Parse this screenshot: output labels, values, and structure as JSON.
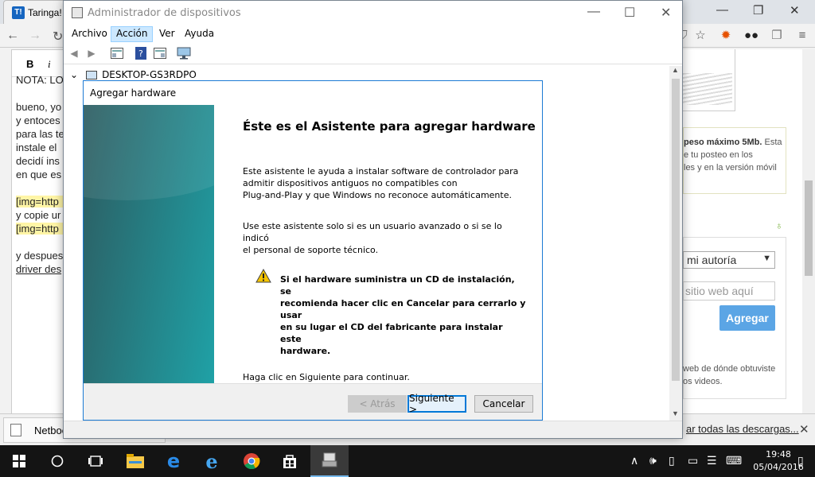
{
  "browser": {
    "tab_title": "Taringa!",
    "tab_logo": "T!",
    "window_controls": {
      "minimize": "—",
      "maximize": "❐",
      "close": "✕"
    },
    "editor": {
      "toolbar": {
        "bold": "B",
        "italic": "i"
      },
      "lines": [
        "NOTA: LO",
        "bueno, yo",
        "y entoces",
        "para las te",
        "instale el",
        "decidí ins",
        "en que es",
        "[img=http",
        "y copie ur",
        "[img=http",
        "y despues",
        "driver des"
      ]
    },
    "right_panel": {
      "upload_note_bold": "peso máximo 5Mb.",
      "upload_note_1": " Esta",
      "upload_note_2": "e tu posteo en los",
      "upload_note_3": "les y en la versión móvil",
      "source_select": "mi autoría",
      "site_placeholder": "sitio web aquí",
      "add_button": "Agregar",
      "source_note_1": "web de dónde obtuviste",
      "source_note_2": "os videos."
    },
    "downloads": {
      "item_name": "Netboo",
      "show_all": "ar todas las descargas..."
    }
  },
  "device_manager": {
    "title": "Administrador de dispositivos",
    "menu": [
      "Archivo",
      "Acción",
      "Ver",
      "Ayuda"
    ],
    "tree_root": "DESKTOP-GS3RDPO"
  },
  "wizard": {
    "title": "Agregar hardware",
    "heading": "Éste es el Asistente para agregar hardware",
    "para1_lines": [
      "Este asistente le ayuda a instalar software de controlador para",
      "admitir dispositivos antiguos no compatibles con",
      "Plug-and-Play y que Windows no reconoce automáticamente."
    ],
    "para2_lines": [
      "Use este asistente solo si es un usuario avanzado o si se lo indicó",
      "el personal de soporte técnico."
    ],
    "warning_lines": [
      "Si el hardware suministra un CD de instalación, se",
      "recomienda hacer clic en Cancelar para cerrarlo y usar",
      "en su lugar el CD del fabricante para instalar este",
      "hardware."
    ],
    "continue_text": "Haga clic en Siguiente para continuar.",
    "back_button": "< Atrás",
    "next_button": "Siguiente >",
    "cancel_button": "Cancelar"
  },
  "taskbar": {
    "time": "19:48",
    "date": "05/04/2016"
  },
  "colors": {
    "wizard_border": "#1c7bd4",
    "taskbar": "#141414",
    "add_button": "#5ba5e5"
  }
}
